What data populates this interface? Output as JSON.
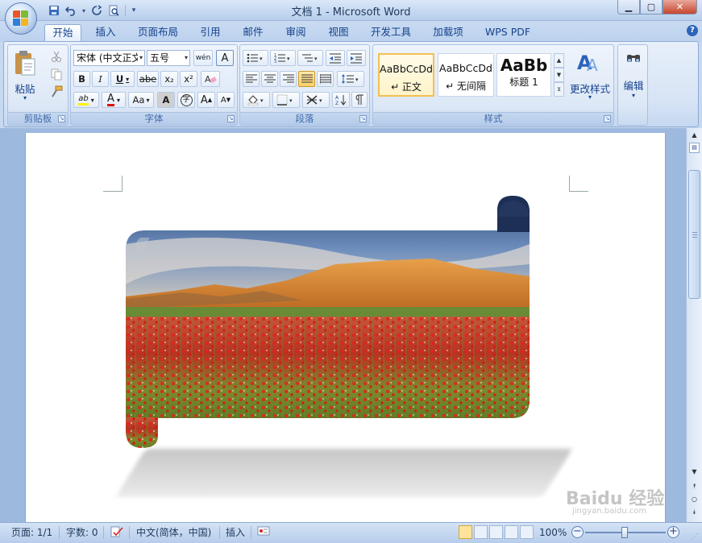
{
  "window": {
    "title": "文档 1 - Microsoft Word",
    "minimize": "▁",
    "maximize": "▢",
    "close": "✕"
  },
  "qat": {
    "save_icon": "💾",
    "undo_icon": "↶",
    "redo_icon": "↻",
    "print_preview_icon": "🔍",
    "dropdown": "▾",
    "customize": "▾"
  },
  "tabs": [
    "开始",
    "插入",
    "页面布局",
    "引用",
    "邮件",
    "审阅",
    "视图",
    "开发工具",
    "加载项",
    "WPS PDF"
  ],
  "active_tab": "开始",
  "ribbon": {
    "clipboard": {
      "label": "剪贴板",
      "paste": "粘贴",
      "paste_arrow": "▾"
    },
    "font": {
      "label": "字体",
      "font_name": "宋体 (中文正文",
      "font_size": "五号",
      "grow": "A",
      "shrink": "A",
      "wen": "wén",
      "bold": "B",
      "italic": "I",
      "underline": "U",
      "strike": "abe",
      "subscript": "x₂",
      "superscript": "x²",
      "clear_format": "A",
      "highlight": "ab",
      "font_color": "A",
      "change_case": "Aa",
      "char_shading": "A",
      "enclose": "字",
      "grow_font": "A",
      "shrink_font": "A"
    },
    "paragraph": {
      "label": "段落"
    },
    "styles": {
      "label": "样式",
      "items": [
        {
          "sample": "AaBbCcDd",
          "name": "↵ 正文"
        },
        {
          "sample": "AaBbCcDd",
          "name": "↵ 无间隔"
        },
        {
          "sample": "AaBb",
          "name": "标题 1"
        }
      ],
      "change_styles": "更改样式"
    },
    "editing": {
      "label": "编辑",
      "arrow": "▾"
    }
  },
  "status": {
    "page": "页面: 1/1",
    "words": "字数: 0",
    "language": "中文(简体，中国)",
    "mode": "插入",
    "zoom": "100%",
    "zoom_out": "−",
    "zoom_in": "+"
  },
  "watermark": {
    "text": "Baidu 经验",
    "sub": "jingyan.baidu.com"
  },
  "colors": {
    "accent": "#15428b",
    "ribbon_bg": "#dde8f6",
    "doc_bg": "#9db9de"
  }
}
